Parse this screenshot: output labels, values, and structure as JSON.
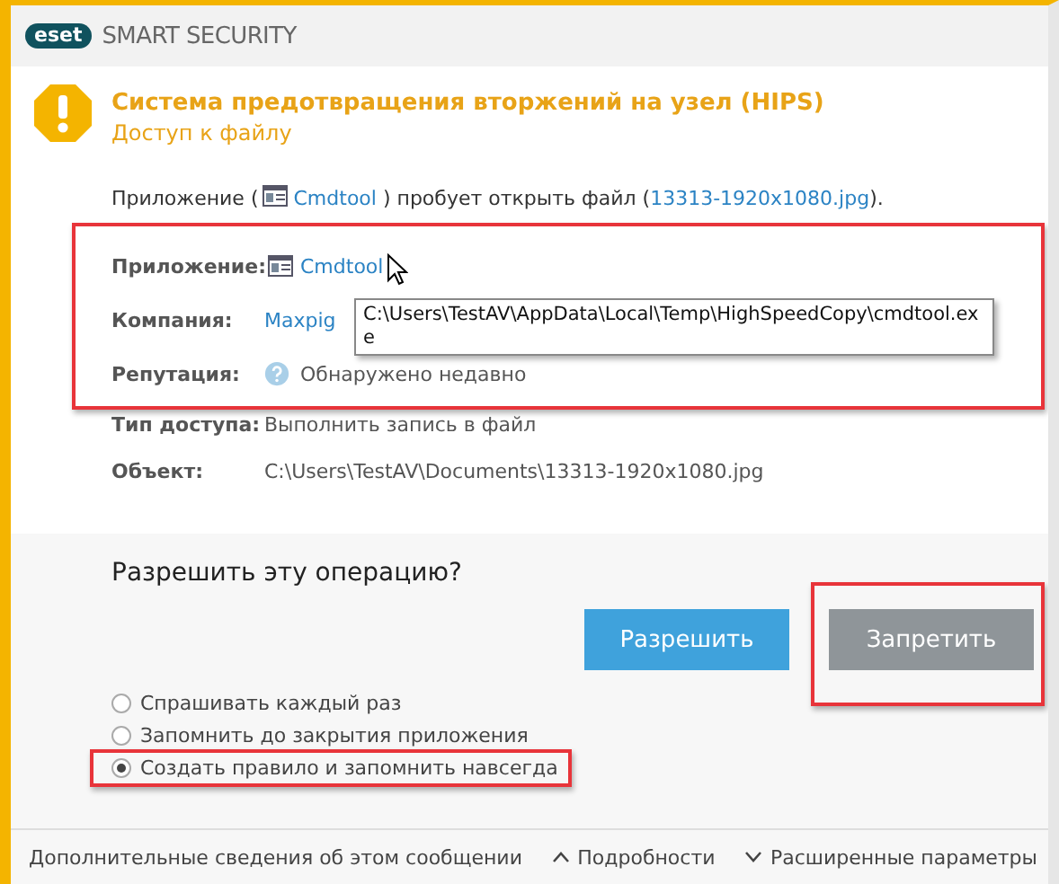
{
  "header": {
    "logo": "eset",
    "product": "SMART SECURITY"
  },
  "alert": {
    "title": "Система предотвращения вторжений на узел (HIPS)",
    "subtitle": "Доступ к файлу"
  },
  "sentence": {
    "prefix": "Приложение (",
    "app_link": "Cmdtool",
    "middle": ") пробует открыть файл (",
    "file_link": "13313-1920x1080.jpg",
    "suffix": ")."
  },
  "detail_groups": [
    {
      "highlighted": true,
      "rows": [
        {
          "kind": "app",
          "label": "Приложение:",
          "value": "Cmdtool"
        },
        {
          "kind": "link",
          "label": "Компания:",
          "value": "Maxpig"
        },
        {
          "kind": "reputation",
          "label": "Репутация:",
          "value": "Обнаружено недавно"
        }
      ]
    },
    {
      "highlighted": false,
      "rows": [
        {
          "kind": "text",
          "label": "Тип доступа:",
          "value": "Выполнить запись в файл"
        },
        {
          "kind": "text",
          "label": "Объект:",
          "value": "C:\\Users\\TestAV\\Documents\\13313-1920x1080.jpg"
        }
      ]
    }
  ],
  "tooltip": "C:\\Users\\TestAV\\AppData\\Local\\Temp\\HighSpeedCopy\\cmdtool.exe",
  "question": "Разрешить эту операцию?",
  "buttons": [
    {
      "label": "Разрешить",
      "kind": "primary",
      "highlighted": false
    },
    {
      "label": "Запретить",
      "kind": "secondary",
      "highlighted": true
    }
  ],
  "options": [
    {
      "label": "Спрашивать каждый раз",
      "selected": false,
      "highlighted": false
    },
    {
      "label": "Запомнить до закрытия приложения",
      "selected": false,
      "highlighted": false
    },
    {
      "label": "Создать правило и запомнить навсегда",
      "selected": true,
      "highlighted": true
    }
  ],
  "footer": [
    {
      "kind": "link",
      "label": "Дополнительные сведения об этом сообщении"
    },
    {
      "kind": "collapse",
      "label": "Подробности"
    },
    {
      "kind": "expand",
      "label": "Расширенные параметры"
    }
  ]
}
